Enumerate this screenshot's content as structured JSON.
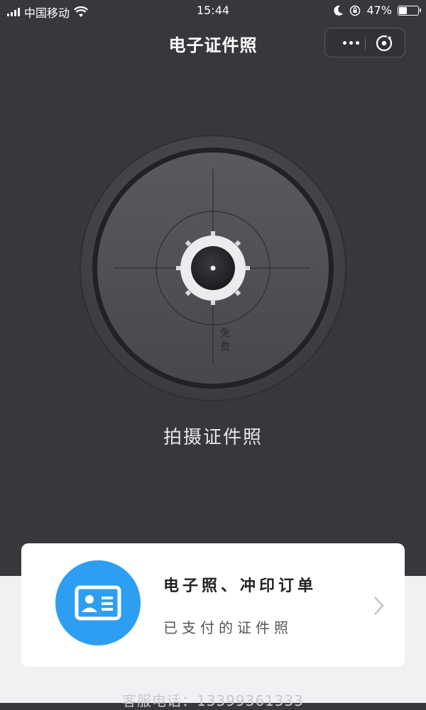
{
  "status_bar": {
    "carrier": "中国移动",
    "time": "15:44",
    "battery": "47%",
    "battery_level": 0.47
  },
  "nav": {
    "title": "电子证件照"
  },
  "dial": {
    "badge": "免费"
  },
  "action_label": "拍摄证件照",
  "card": {
    "title": "电子照、冲印订单",
    "subtitle": "已支付的证件照"
  },
  "footer": {
    "phone": "客服电话：13399361333"
  },
  "icons": [
    "signal-icon",
    "wifi-icon",
    "moon-icon",
    "orientation-lock-icon",
    "battery-icon",
    "more-icon",
    "close-icon",
    "camera-icon",
    "id-card-icon",
    "chevron-right-icon"
  ],
  "colors": {
    "background": "#38373c",
    "accent": "#2e9ef2",
    "card": "#ffffff",
    "bottom": "#f1f1f4"
  }
}
